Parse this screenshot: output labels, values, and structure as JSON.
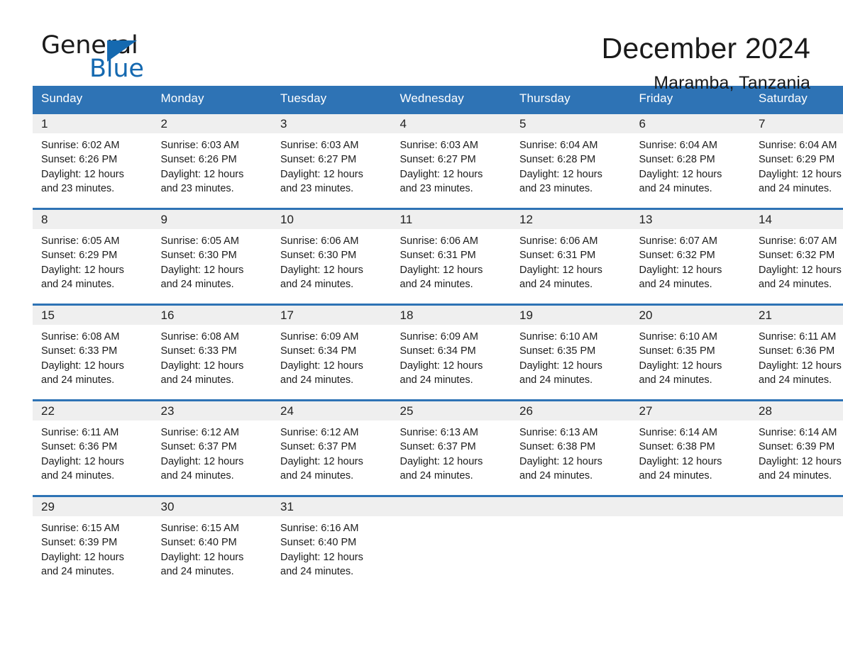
{
  "brand": {
    "name_part1": "General",
    "name_part2": "Blue",
    "accent_color": "#1569b0"
  },
  "header": {
    "title": "December 2024",
    "location": "Maramba, Tanzania"
  },
  "theme": {
    "header_blue": "#2e73b5",
    "daynum_band": "#efefef",
    "text": "#1c1c1c"
  },
  "weekdays": [
    "Sunday",
    "Monday",
    "Tuesday",
    "Wednesday",
    "Thursday",
    "Friday",
    "Saturday"
  ],
  "weeks": [
    [
      {
        "day": "1",
        "sunrise": "Sunrise: 6:02 AM",
        "sunset": "Sunset: 6:26 PM",
        "daylight_line1": "Daylight: 12 hours",
        "daylight_line2": "and 23 minutes."
      },
      {
        "day": "2",
        "sunrise": "Sunrise: 6:03 AM",
        "sunset": "Sunset: 6:26 PM",
        "daylight_line1": "Daylight: 12 hours",
        "daylight_line2": "and 23 minutes."
      },
      {
        "day": "3",
        "sunrise": "Sunrise: 6:03 AM",
        "sunset": "Sunset: 6:27 PM",
        "daylight_line1": "Daylight: 12 hours",
        "daylight_line2": "and 23 minutes."
      },
      {
        "day": "4",
        "sunrise": "Sunrise: 6:03 AM",
        "sunset": "Sunset: 6:27 PM",
        "daylight_line1": "Daylight: 12 hours",
        "daylight_line2": "and 23 minutes."
      },
      {
        "day": "5",
        "sunrise": "Sunrise: 6:04 AM",
        "sunset": "Sunset: 6:28 PM",
        "daylight_line1": "Daylight: 12 hours",
        "daylight_line2": "and 23 minutes."
      },
      {
        "day": "6",
        "sunrise": "Sunrise: 6:04 AM",
        "sunset": "Sunset: 6:28 PM",
        "daylight_line1": "Daylight: 12 hours",
        "daylight_line2": "and 24 minutes."
      },
      {
        "day": "7",
        "sunrise": "Sunrise: 6:04 AM",
        "sunset": "Sunset: 6:29 PM",
        "daylight_line1": "Daylight: 12 hours",
        "daylight_line2": "and 24 minutes."
      }
    ],
    [
      {
        "day": "8",
        "sunrise": "Sunrise: 6:05 AM",
        "sunset": "Sunset: 6:29 PM",
        "daylight_line1": "Daylight: 12 hours",
        "daylight_line2": "and 24 minutes."
      },
      {
        "day": "9",
        "sunrise": "Sunrise: 6:05 AM",
        "sunset": "Sunset: 6:30 PM",
        "daylight_line1": "Daylight: 12 hours",
        "daylight_line2": "and 24 minutes."
      },
      {
        "day": "10",
        "sunrise": "Sunrise: 6:06 AM",
        "sunset": "Sunset: 6:30 PM",
        "daylight_line1": "Daylight: 12 hours",
        "daylight_line2": "and 24 minutes."
      },
      {
        "day": "11",
        "sunrise": "Sunrise: 6:06 AM",
        "sunset": "Sunset: 6:31 PM",
        "daylight_line1": "Daylight: 12 hours",
        "daylight_line2": "and 24 minutes."
      },
      {
        "day": "12",
        "sunrise": "Sunrise: 6:06 AM",
        "sunset": "Sunset: 6:31 PM",
        "daylight_line1": "Daylight: 12 hours",
        "daylight_line2": "and 24 minutes."
      },
      {
        "day": "13",
        "sunrise": "Sunrise: 6:07 AM",
        "sunset": "Sunset: 6:32 PM",
        "daylight_line1": "Daylight: 12 hours",
        "daylight_line2": "and 24 minutes."
      },
      {
        "day": "14",
        "sunrise": "Sunrise: 6:07 AM",
        "sunset": "Sunset: 6:32 PM",
        "daylight_line1": "Daylight: 12 hours",
        "daylight_line2": "and 24 minutes."
      }
    ],
    [
      {
        "day": "15",
        "sunrise": "Sunrise: 6:08 AM",
        "sunset": "Sunset: 6:33 PM",
        "daylight_line1": "Daylight: 12 hours",
        "daylight_line2": "and 24 minutes."
      },
      {
        "day": "16",
        "sunrise": "Sunrise: 6:08 AM",
        "sunset": "Sunset: 6:33 PM",
        "daylight_line1": "Daylight: 12 hours",
        "daylight_line2": "and 24 minutes."
      },
      {
        "day": "17",
        "sunrise": "Sunrise: 6:09 AM",
        "sunset": "Sunset: 6:34 PM",
        "daylight_line1": "Daylight: 12 hours",
        "daylight_line2": "and 24 minutes."
      },
      {
        "day": "18",
        "sunrise": "Sunrise: 6:09 AM",
        "sunset": "Sunset: 6:34 PM",
        "daylight_line1": "Daylight: 12 hours",
        "daylight_line2": "and 24 minutes."
      },
      {
        "day": "19",
        "sunrise": "Sunrise: 6:10 AM",
        "sunset": "Sunset: 6:35 PM",
        "daylight_line1": "Daylight: 12 hours",
        "daylight_line2": "and 24 minutes."
      },
      {
        "day": "20",
        "sunrise": "Sunrise: 6:10 AM",
        "sunset": "Sunset: 6:35 PM",
        "daylight_line1": "Daylight: 12 hours",
        "daylight_line2": "and 24 minutes."
      },
      {
        "day": "21",
        "sunrise": "Sunrise: 6:11 AM",
        "sunset": "Sunset: 6:36 PM",
        "daylight_line1": "Daylight: 12 hours",
        "daylight_line2": "and 24 minutes."
      }
    ],
    [
      {
        "day": "22",
        "sunrise": "Sunrise: 6:11 AM",
        "sunset": "Sunset: 6:36 PM",
        "daylight_line1": "Daylight: 12 hours",
        "daylight_line2": "and 24 minutes."
      },
      {
        "day": "23",
        "sunrise": "Sunrise: 6:12 AM",
        "sunset": "Sunset: 6:37 PM",
        "daylight_line1": "Daylight: 12 hours",
        "daylight_line2": "and 24 minutes."
      },
      {
        "day": "24",
        "sunrise": "Sunrise: 6:12 AM",
        "sunset": "Sunset: 6:37 PM",
        "daylight_line1": "Daylight: 12 hours",
        "daylight_line2": "and 24 minutes."
      },
      {
        "day": "25",
        "sunrise": "Sunrise: 6:13 AM",
        "sunset": "Sunset: 6:37 PM",
        "daylight_line1": "Daylight: 12 hours",
        "daylight_line2": "and 24 minutes."
      },
      {
        "day": "26",
        "sunrise": "Sunrise: 6:13 AM",
        "sunset": "Sunset: 6:38 PM",
        "daylight_line1": "Daylight: 12 hours",
        "daylight_line2": "and 24 minutes."
      },
      {
        "day": "27",
        "sunrise": "Sunrise: 6:14 AM",
        "sunset": "Sunset: 6:38 PM",
        "daylight_line1": "Daylight: 12 hours",
        "daylight_line2": "and 24 minutes."
      },
      {
        "day": "28",
        "sunrise": "Sunrise: 6:14 AM",
        "sunset": "Sunset: 6:39 PM",
        "daylight_line1": "Daylight: 12 hours",
        "daylight_line2": "and 24 minutes."
      }
    ],
    [
      {
        "day": "29",
        "sunrise": "Sunrise: 6:15 AM",
        "sunset": "Sunset: 6:39 PM",
        "daylight_line1": "Daylight: 12 hours",
        "daylight_line2": "and 24 minutes."
      },
      {
        "day": "30",
        "sunrise": "Sunrise: 6:15 AM",
        "sunset": "Sunset: 6:40 PM",
        "daylight_line1": "Daylight: 12 hours",
        "daylight_line2": "and 24 minutes."
      },
      {
        "day": "31",
        "sunrise": "Sunrise: 6:16 AM",
        "sunset": "Sunset: 6:40 PM",
        "daylight_line1": "Daylight: 12 hours",
        "daylight_line2": "and 24 minutes."
      },
      {
        "day": "",
        "sunrise": "",
        "sunset": "",
        "daylight_line1": "",
        "daylight_line2": ""
      },
      {
        "day": "",
        "sunrise": "",
        "sunset": "",
        "daylight_line1": "",
        "daylight_line2": ""
      },
      {
        "day": "",
        "sunrise": "",
        "sunset": "",
        "daylight_line1": "",
        "daylight_line2": ""
      },
      {
        "day": "",
        "sunrise": "",
        "sunset": "",
        "daylight_line1": "",
        "daylight_line2": ""
      }
    ]
  ]
}
